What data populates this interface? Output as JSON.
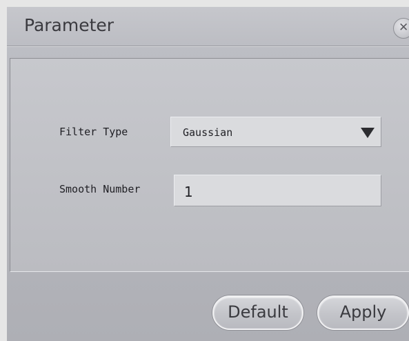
{
  "dialog": {
    "title": "Parameter",
    "close_icon": "close-icon"
  },
  "form": {
    "filter_type_label": "Filter Type",
    "filter_type_value": "Gaussian",
    "dropdown_icon": "chevron-down-icon",
    "smooth_number_label": "Smooth Number",
    "smooth_number_value": "1"
  },
  "buttons": {
    "default_label": "Default",
    "apply_label": "Apply"
  }
}
